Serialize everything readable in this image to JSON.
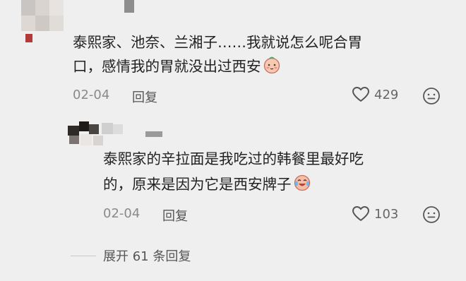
{
  "comments": [
    {
      "text_line1": "泰熙家、池奈、兰湘子……我就说怎么呢合胃",
      "text_line2": "口，感情我的胃就没出过西安",
      "emoji": "shy-face-emoji",
      "date": "02-04",
      "reply_label": "回复",
      "like_count": "429"
    },
    {
      "text_line1": "泰熙家的辛拉面是我吃过的韩餐里最好吃",
      "text_line2": "的，原来是因为它是西安牌子",
      "emoji": "laughing-crying-emoji",
      "date": "02-04",
      "reply_label": "回复",
      "like_count": "103"
    }
  ],
  "expand_replies": "展开 61 条回复",
  "colors": {
    "background": "#efefef",
    "text": "#222222",
    "meta": "#8a8a8a",
    "icon": "#555555"
  }
}
